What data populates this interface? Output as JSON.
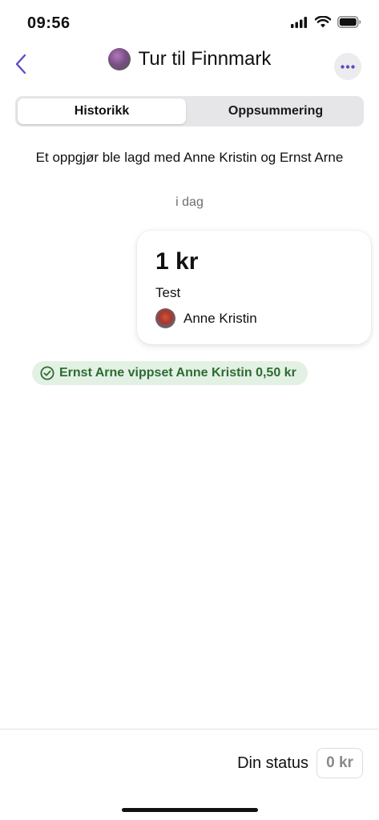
{
  "status_bar": {
    "time": "09:56",
    "icons": [
      "signal-icon",
      "wifi-icon",
      "battery-icon"
    ]
  },
  "header": {
    "title": "Tur til Finnmark",
    "back_icon": "chevron-left-icon",
    "more_icon": "ellipsis-icon"
  },
  "tabs": [
    {
      "label": "Historikk",
      "active": true
    },
    {
      "label": "Oppsummering",
      "active": false
    }
  ],
  "history": {
    "settlement_message": "Et oppgjør ble lagd med Anne Kristin og Ernst Arne",
    "date_label": "i dag",
    "expense": {
      "amount": "1 kr",
      "description": "Test",
      "payer": "Anne Kristin"
    },
    "payment": {
      "text": "Ernst Arne vippset Anne Kristin 0,50 kr",
      "icon": "check-circle-icon"
    }
  },
  "footer": {
    "status_label": "Din status",
    "status_value": "0 kr"
  },
  "colors": {
    "accent": "#5b4fc4",
    "payment_green": "#2e6b33",
    "payment_bg": "#e3f1e4",
    "segment_bg": "#e6e6e8"
  }
}
